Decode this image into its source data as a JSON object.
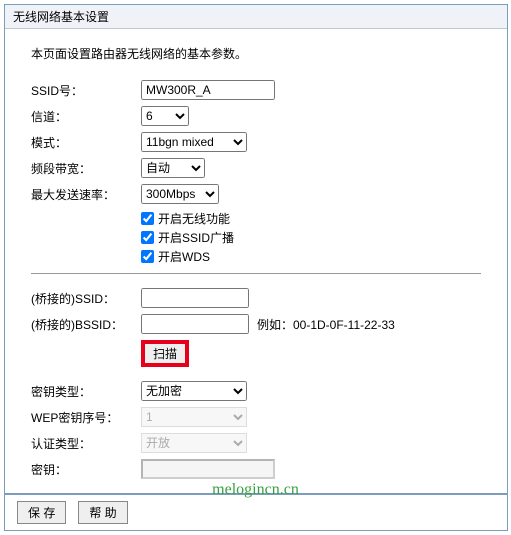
{
  "panel": {
    "title": "无线网络基本设置",
    "intro": "本页面设置路由器无线网络的基本参数。"
  },
  "fields": {
    "ssid_label": "SSID号：",
    "ssid_value": "MW300R_A",
    "channel_label": "信道：",
    "channel_value": "6",
    "mode_label": "模式：",
    "mode_value": "11bgn mixed",
    "bandwidth_label": "频段带宽：",
    "bandwidth_value": "自动",
    "rate_label": "最大发送速率：",
    "rate_value": "300Mbps",
    "chk_enable": "开启无线功能",
    "chk_broadcast": "开启SSID广播",
    "chk_wds": "开启WDS"
  },
  "wds": {
    "br_ssid_label": "(桥接的)SSID：",
    "br_ssid_value": "",
    "br_bssid_label": "(桥接的)BSSID：",
    "br_bssid_value": "",
    "bssid_example": "例如：00-1D-0F-11-22-33",
    "scan_label": "扫描",
    "enc_label": "密钥类型：",
    "enc_value": "无加密",
    "wepidx_label": "WEP密钥序号：",
    "wepidx_value": "1",
    "auth_label": "认证类型：",
    "auth_value": "开放",
    "key_label": "密钥：",
    "key_value": ""
  },
  "footer": {
    "save": "保 存",
    "help": "帮 助"
  },
  "watermark": "melogincn.cn"
}
